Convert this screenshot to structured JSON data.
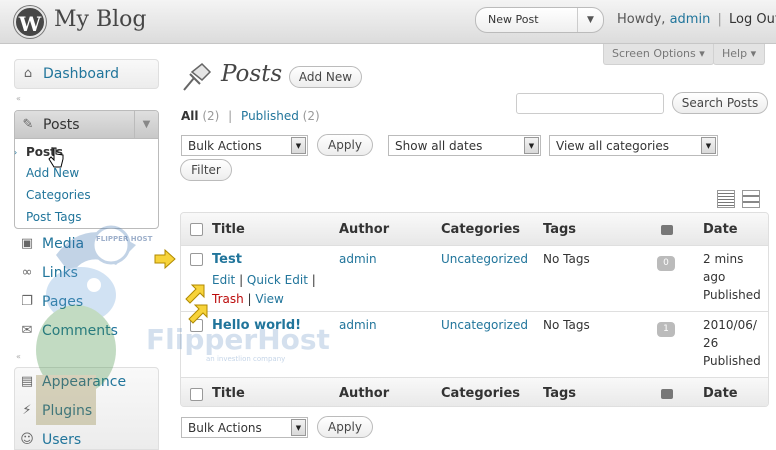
{
  "header": {
    "wp_logo": "W",
    "site_title": "My Blog",
    "favorite_actions": {
      "label": "New Post"
    },
    "howdy_prefix": "Howdy,",
    "user": "admin",
    "separator": "|",
    "logout": "Log Out"
  },
  "screen_meta": {
    "screen_options": "Screen Options ▾",
    "help": "Help ▾"
  },
  "menu": {
    "dashboard": "Dashboard",
    "posts": "Posts",
    "posts_submenu": [
      "Posts",
      "Add New",
      "Categories",
      "Post Tags"
    ],
    "media": "Media",
    "links": "Links",
    "pages": "Pages",
    "comments": "Comments",
    "appearance": "Appearance",
    "plugins": "Plugins",
    "users": "Users"
  },
  "page": {
    "title": "Posts",
    "add_new": "Add New",
    "filters": {
      "all_label": "All",
      "all_count": "(2)",
      "sep": "|",
      "published_label": "Published",
      "published_count": "(2)"
    },
    "search": {
      "value": "",
      "button": "Search Posts"
    },
    "bulk_actions": "Bulk Actions",
    "apply": "Apply",
    "dates": "Show all dates",
    "categories": "View all categories",
    "filter": "Filter"
  },
  "table": {
    "columns": {
      "title": "Title",
      "author": "Author",
      "categories": "Categories",
      "tags": "Tags",
      "date": "Date"
    },
    "rows": [
      {
        "title": "Test",
        "actions": {
          "edit": "Edit",
          "quick_edit": "Quick Edit",
          "trash": "Trash",
          "view": "View"
        },
        "author": "admin",
        "categories": "Uncategorized",
        "tags": "No Tags",
        "comments": "0",
        "date_line1": "2 mins",
        "date_line2": "ago",
        "status": "Published"
      },
      {
        "title": "Hello world!",
        "author": "admin",
        "categories": "Uncategorized",
        "tags": "No Tags",
        "comments": "1",
        "date_line1": "2010/06/",
        "date_line2": "26",
        "status": "Published"
      }
    ]
  },
  "bottom": {
    "bulk_actions": "Bulk Actions",
    "apply": "Apply"
  },
  "watermark": {
    "brand": "FlipperHost",
    "tagline": "an investlion company",
    "badge": "FLIPPER HOST"
  },
  "colors": {
    "link": "#21759b",
    "trash": "#bc0b0b",
    "header": "#dcdcdc"
  }
}
